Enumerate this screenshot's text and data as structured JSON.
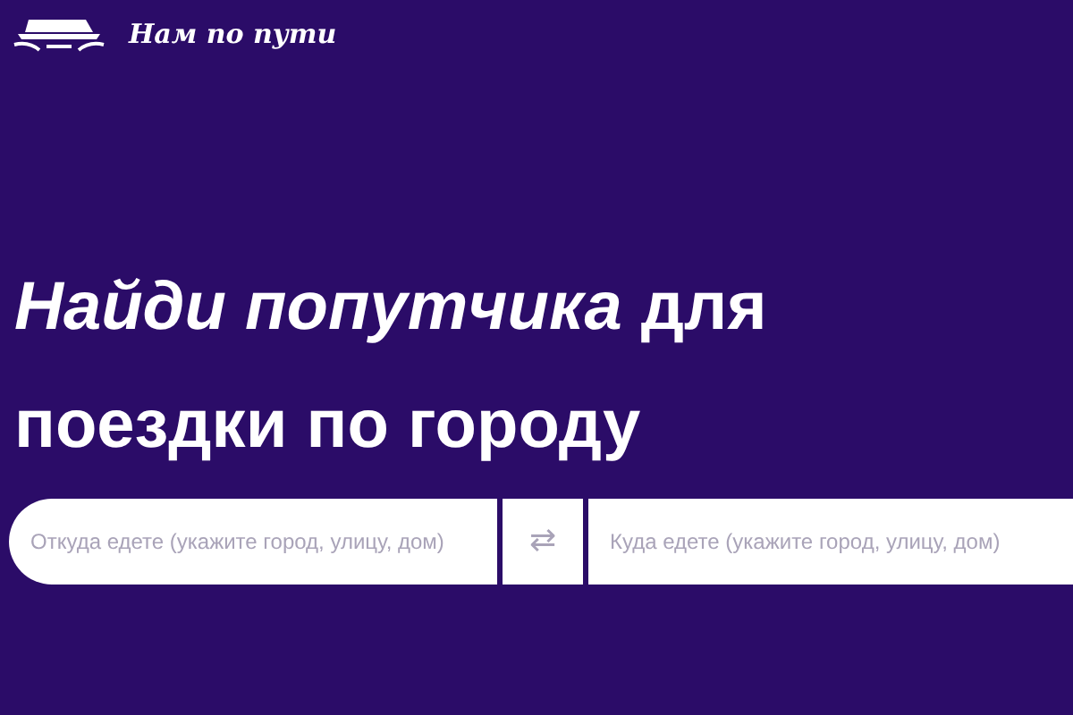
{
  "logo": {
    "text": "Нам по пути"
  },
  "headline": "*Найди попутчика* для поездки по городу",
  "search": {
    "from": {
      "placeholder": "Откуда едете (укажите город, улицу, дом)"
    },
    "swap": {
      "text": "⇄"
    },
    "to": {
      "placeholder": "Куда едете (укажите город, улицу, дом)"
    }
  }
}
